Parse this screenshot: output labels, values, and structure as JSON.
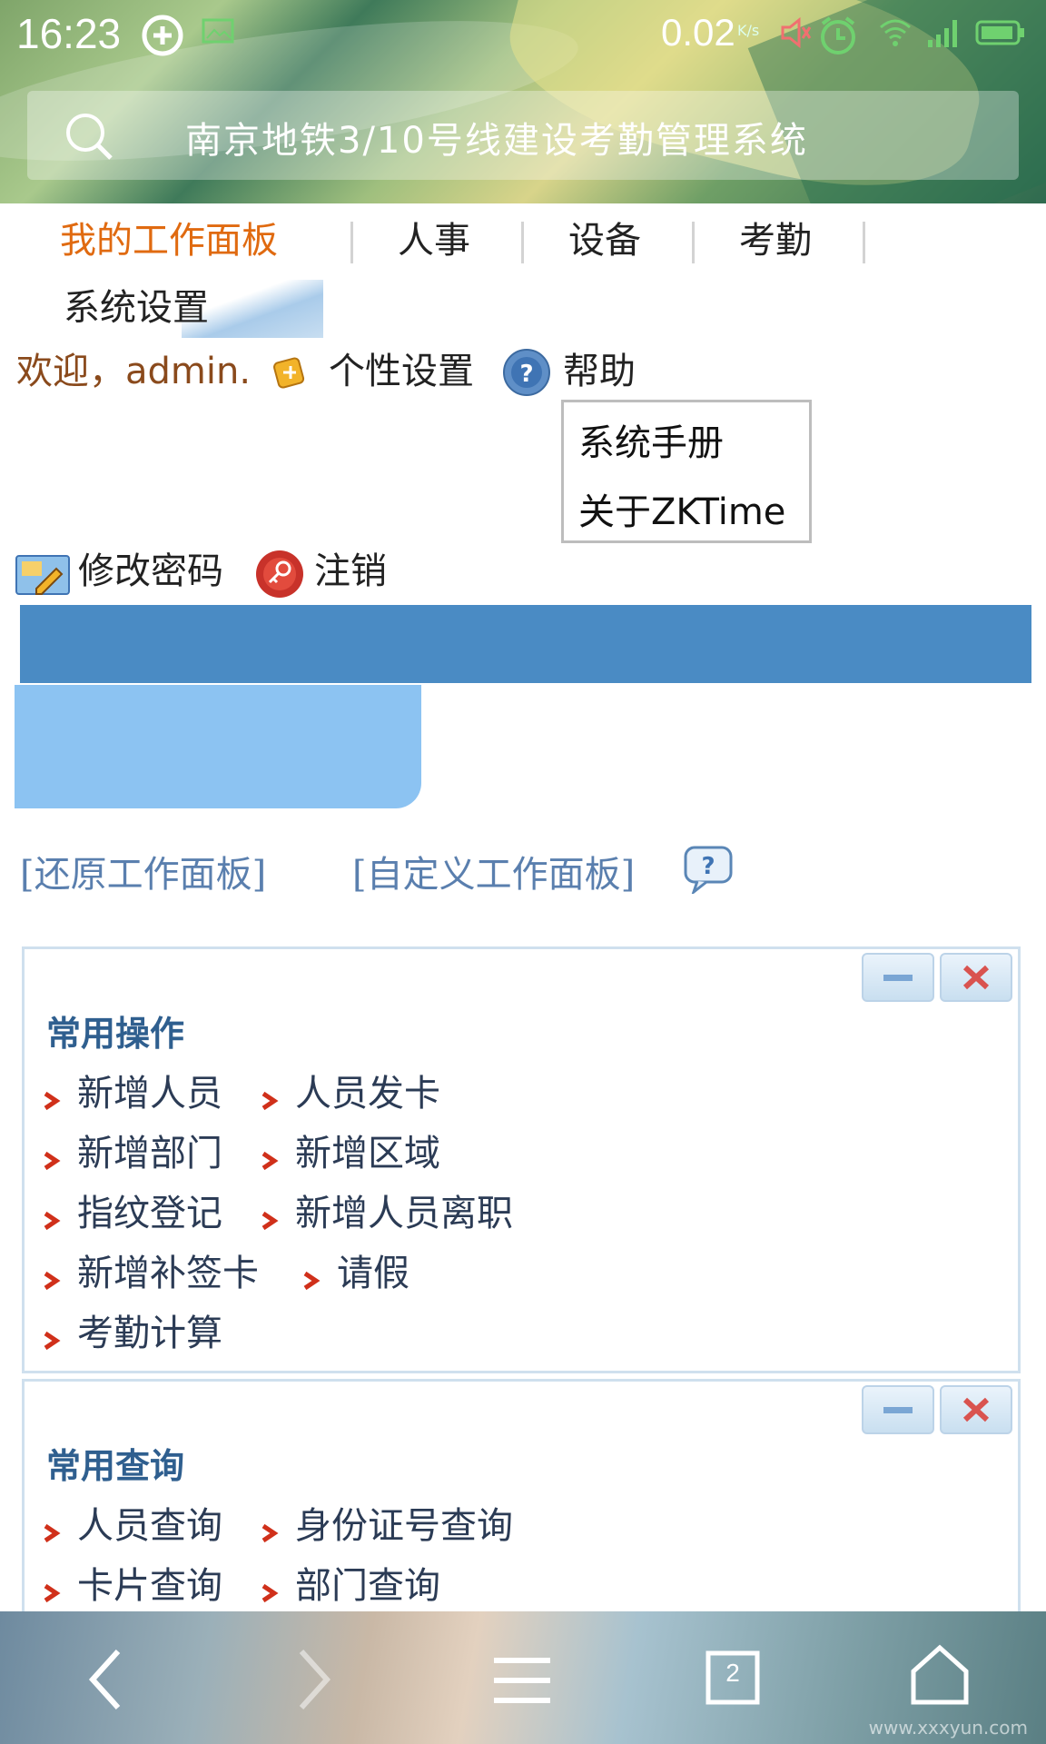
{
  "status_bar": {
    "time": "16:23",
    "net_speed": "0.02",
    "net_unit": "K/s"
  },
  "search": {
    "text": "南京地铁3/10号线建设考勤管理系统"
  },
  "nav": {
    "tabs": [
      "我的工作面板",
      "人事",
      "设备",
      "考勤",
      "系统设置"
    ],
    "active_color": "#e06a10"
  },
  "user_bar": {
    "welcome": "欢迎，admin.",
    "personal_settings": "个性设置",
    "help": "帮助",
    "change_password": "修改密码",
    "logout": "注销"
  },
  "help_menu": {
    "items": [
      "系统手册",
      "关于ZKTime"
    ]
  },
  "colors": {
    "header_bar": "#4a8bc4",
    "sub_block": "#8cc3f2",
    "link": "#5a7fae",
    "panel_title": "#2f5f8f"
  },
  "dashboard_links": {
    "restore": "[还原工作面板]",
    "customize": "[自定义工作面板]"
  },
  "panels": [
    {
      "title": "常用操作",
      "rows": [
        [
          "新增人员",
          "人员发卡"
        ],
        [
          "新增部门",
          "新增区域"
        ],
        [
          "指纹登记",
          "新增人员离职"
        ],
        [
          "新增补签卡",
          "请假"
        ],
        [
          "考勤计算"
        ]
      ]
    },
    {
      "title": "常用查询",
      "rows": [
        [
          "人员查询",
          "身份证号查询"
        ],
        [
          "卡片查询",
          "部门查询"
        ]
      ]
    }
  ],
  "bottom_nav": {
    "tab_count": "2",
    "watermark": "www.xxxyun.com"
  }
}
